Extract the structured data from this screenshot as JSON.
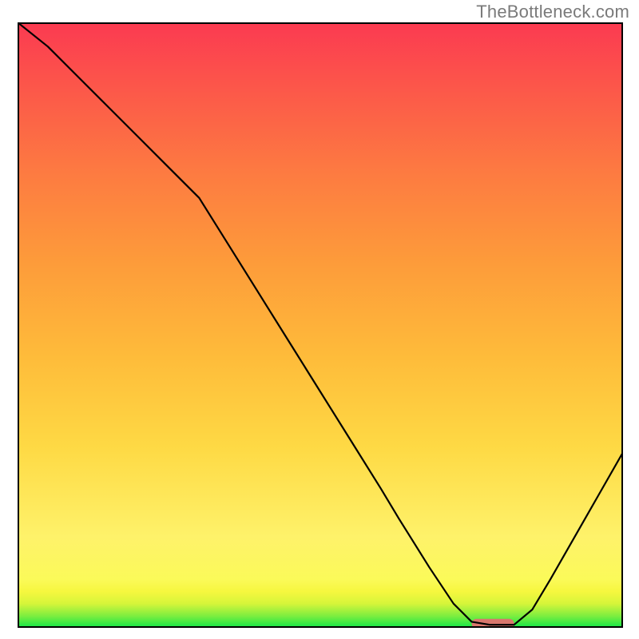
{
  "watermark": "TheBottleneck.com",
  "chart_data": {
    "type": "line",
    "title": "",
    "xlabel": "",
    "ylabel": "",
    "xlim": [
      0,
      100
    ],
    "ylim": [
      0,
      100
    ],
    "grid": false,
    "series": [
      {
        "name": "bottleneck-curve",
        "x": [
          0,
          5,
          10,
          15,
          20,
          25,
          30,
          35,
          40,
          45,
          50,
          55,
          60,
          63,
          68,
          72,
          75,
          78,
          80,
          82,
          85,
          88,
          92,
          96,
          100
        ],
        "y": [
          100,
          96,
          91,
          86,
          81,
          76,
          71,
          63,
          55,
          47,
          39,
          31,
          23,
          18,
          10,
          4,
          1,
          0.5,
          0.5,
          0.5,
          3,
          8,
          15,
          22,
          29
        ]
      }
    ],
    "marker": {
      "name": "optimal-range",
      "x_start": 75,
      "x_end": 82,
      "y": 0.7,
      "color": "#d9776d"
    },
    "gradient_stops": [
      {
        "offset": 0,
        "color": "#11e648"
      },
      {
        "offset": 2,
        "color": "#7fee3f"
      },
      {
        "offset": 4,
        "color": "#d6f53a"
      },
      {
        "offset": 6,
        "color": "#f6f73f"
      },
      {
        "offset": 8,
        "color": "#fbfa59"
      },
      {
        "offset": 15,
        "color": "#fef26a"
      },
      {
        "offset": 30,
        "color": "#fed944"
      },
      {
        "offset": 45,
        "color": "#febb3a"
      },
      {
        "offset": 60,
        "color": "#fd9c3a"
      },
      {
        "offset": 75,
        "color": "#fd7b41"
      },
      {
        "offset": 88,
        "color": "#fc5a49"
      },
      {
        "offset": 100,
        "color": "#fb3a51"
      }
    ]
  }
}
